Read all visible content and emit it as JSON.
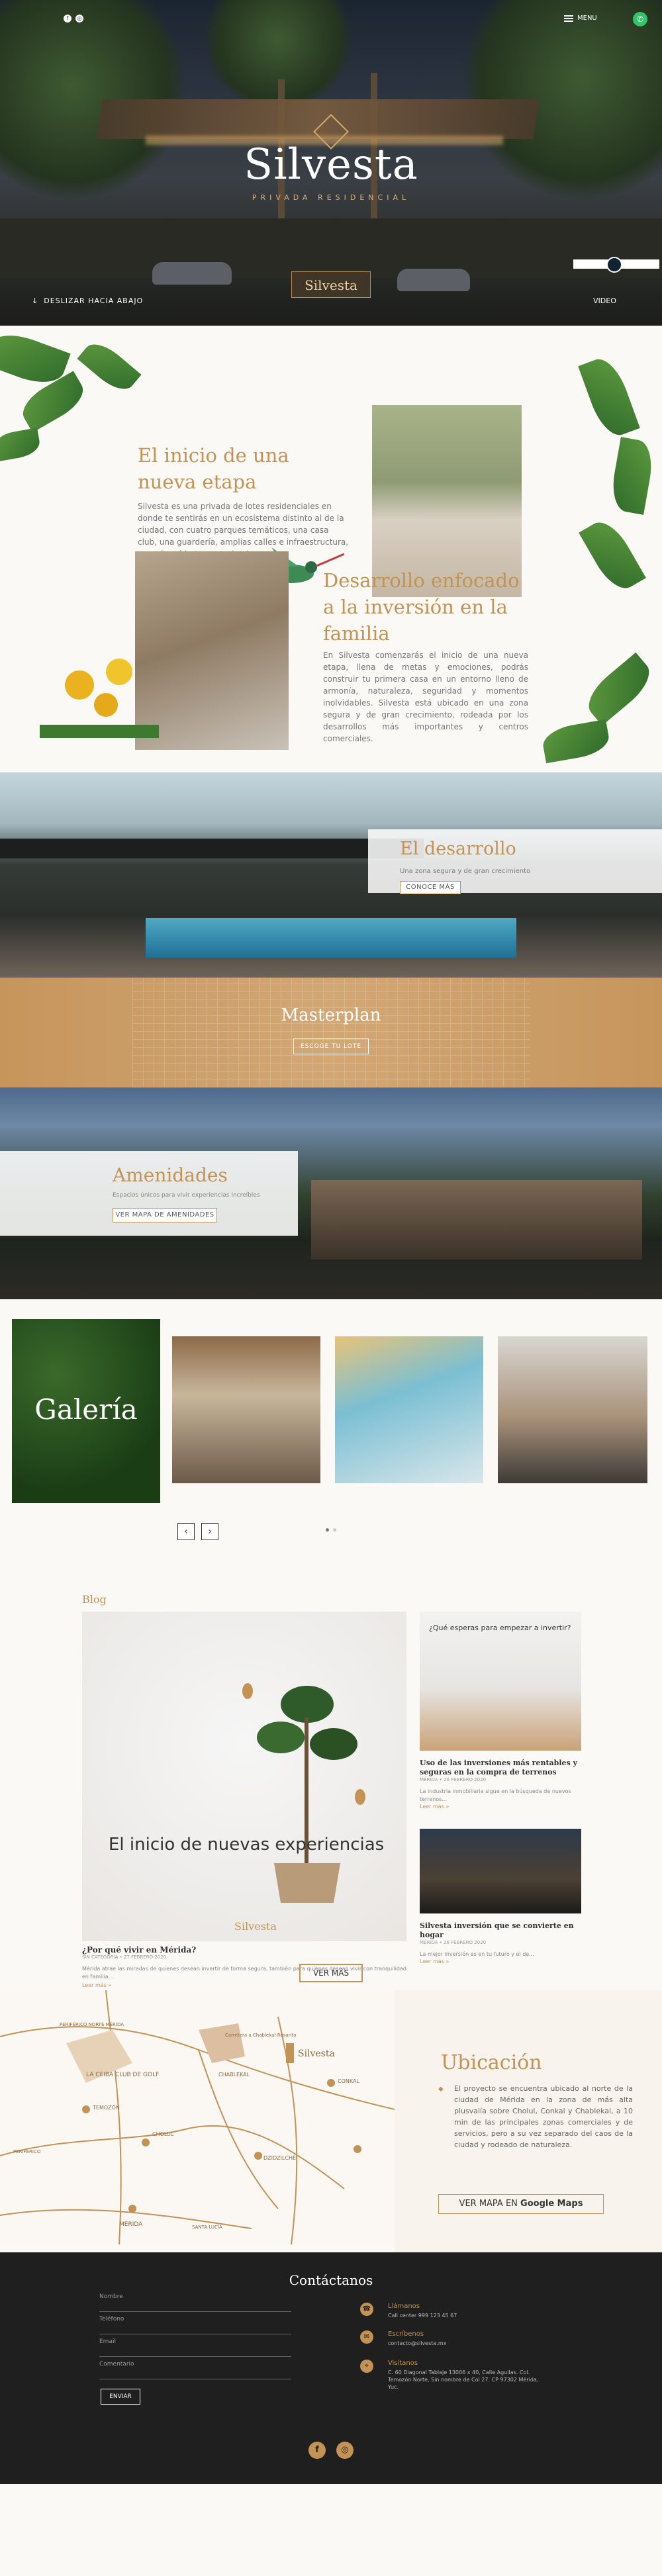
{
  "hero": {
    "title": "Silvesta",
    "subtitle": "PRIVADA RESIDENCIAL",
    "sign": "Silvesta",
    "menu_label": "MENU",
    "scroll_label": "DESLIZAR HACIA ABAJO",
    "video_label": "VIDEO"
  },
  "about1": {
    "heading": "El inicio de una nueva etapa",
    "text": "Silvesta es una privada de lotes residenciales en donde te sentirás en un ecosistema distinto al de la ciudad, con cuatro parques temáticos, una casa club, una guardería, amplias calles e infraestructura, espacios abiertos y equipados."
  },
  "about2": {
    "heading": "Desarrollo enfocado a la inversión en la familia",
    "text": "En Silvesta comenzarás el inicio de una nueva etapa, llena de metas y emociones, podrás construir tu primera casa en un entorno lleno de armonía, naturaleza, seguridad y momentos inolvidables. Silvesta está ubicado en una zona segura y de gran crecimiento, rodeada por los desarrollos más importantes y centros comerciales."
  },
  "desarrollo": {
    "heading": "El desarrollo",
    "text": "Una zona segura y de gran crecimiento",
    "button": "CONOCE MÁS"
  },
  "masterplan": {
    "heading": "Masterplan",
    "button": "ESCOGE TU LOTE"
  },
  "amenidades": {
    "heading": "Amenidades",
    "text": "Espacios únicos para vivir experiencias increíbles",
    "button": "VER MAPA DE AMENIDADES"
  },
  "galeria": {
    "title": "Galería",
    "prev": "‹",
    "next": "›"
  },
  "blog": {
    "label": "Blog",
    "featured": {
      "image_text": "El inicio de nuevas experiencias",
      "image_brand": "Silvesta",
      "title": "¿Por qué vivir en Mérida?",
      "meta": "SIN CATEGORÍA • 27 FEBRERO 2020",
      "excerpt": "Mérida atrae las miradas de quienes desean invertir de forma segura, también para quienes desean vivir con tranquilidad en familia...",
      "more": "Leer más »"
    },
    "side": [
      {
        "image_text": "¿Qué esperas para empezar a invertir?",
        "title": "Uso de las inversiones más rentables y seguras en la compra de terrenos",
        "meta": "MÉRIDA • 26 FEBRERO 2020",
        "excerpt": "La industria inmobiliaria sigue en la búsqueda de nuevos terrenos...",
        "more": "Leer más »"
      },
      {
        "title": "Silvesta inversión que se convierte en hogar",
        "meta": "MÉRIDA • 26 FEBRERO 2020",
        "excerpt": "La mejor inversión es en tu futuro y el de...",
        "more": "Leer más »"
      }
    ],
    "button": "VER MÁS"
  },
  "ubicacion": {
    "heading": "Ubicación",
    "bullets": [
      "El proyecto se encuentra ubicado al norte de la ciudad de Mérida en la zona de más alta plusvalía sobre Cholul, Conkal y Chablekal, a 10 min de las principales zonas comerciales y de servicios, pero a su vez separado del caos de la ciudad y rodeado de naturaleza."
    ],
    "button_prefix": "VER MAPA EN",
    "button_brand": "Google Maps",
    "map_labels": [
      "PERIFÉRICO NORTE MÉRIDA",
      "Carretera a Chablekal-Rosarito",
      "LA CEIBA CLUB DE GOLF",
      "CHABLEKAL",
      "Silvesta",
      "CONKAL",
      "TEMOZÓN",
      "CHOLUL",
      "DZIDZILCHÉ",
      "PERIFÉRICO",
      "MÉRIDA",
      "SANTA LUCÍA"
    ]
  },
  "contacto": {
    "heading": "Contáctanos",
    "fields": [
      "Nombre",
      "Teléfono",
      "Email",
      "Comentario"
    ],
    "send": "ENVIAR",
    "info": [
      {
        "icon": "phone-icon",
        "title": "Llámanos",
        "value": "Call center 999 123 45 67"
      },
      {
        "icon": "mail-icon",
        "title": "Escríbenos",
        "value": "contacto@silvesta.mx"
      },
      {
        "icon": "pin-icon",
        "title": "Visítanos",
        "value": "C. 60 Diagonal Tablaje 13006 x 40, Calle Aguilas. Col. Temozón Norte, Sin nombre de Col 27. CP 97302 Mérida, Yuc."
      }
    ],
    "social": [
      "f",
      "◎"
    ]
  },
  "colors": {
    "accent": "#c39255",
    "footer": "#1f1f1f",
    "background": "#fbf9f5"
  }
}
